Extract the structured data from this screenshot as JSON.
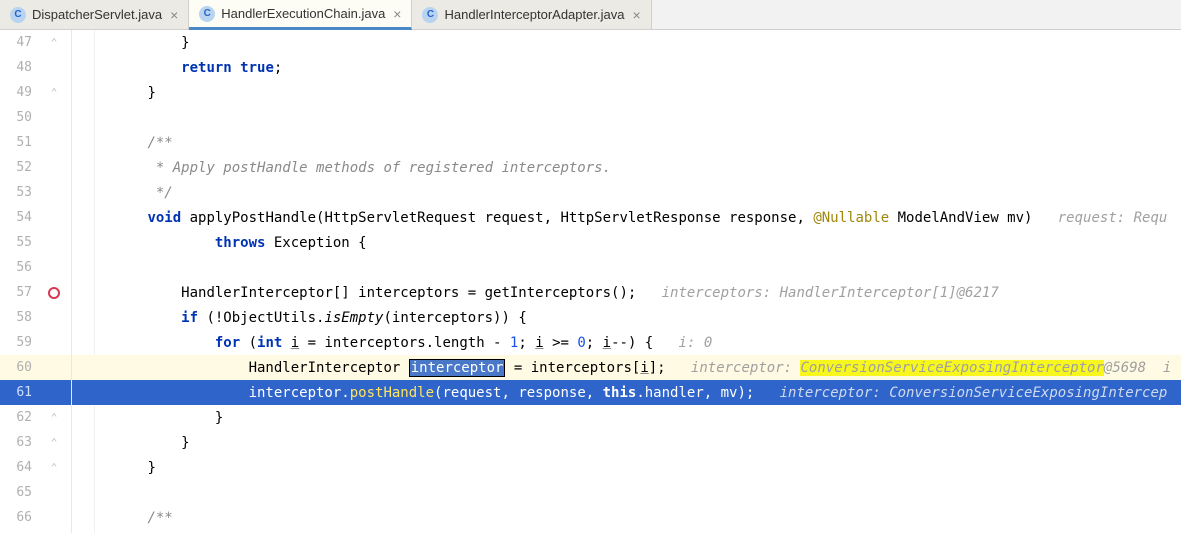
{
  "tabs": [
    {
      "label": "DispatcherServlet.java",
      "active": false
    },
    {
      "label": "HandlerExecutionChain.java",
      "active": true
    },
    {
      "label": "HandlerInterceptorAdapter.java",
      "active": false
    }
  ],
  "icon_letter": "C",
  "lines": [
    {
      "no": "47",
      "marker": "fold",
      "indent": "            ",
      "tokens": [
        {
          "t": "}",
          "c": ""
        }
      ]
    },
    {
      "no": "48",
      "marker": "",
      "indent": "            ",
      "tokens": [
        {
          "t": "return true",
          "c": "kw"
        },
        {
          "t": ";",
          "c": ""
        }
      ]
    },
    {
      "no": "49",
      "marker": "fold",
      "indent": "        ",
      "tokens": [
        {
          "t": "}",
          "c": ""
        }
      ]
    },
    {
      "no": "50",
      "marker": "",
      "indent": "",
      "tokens": []
    },
    {
      "no": "51",
      "marker": "",
      "indent": "        ",
      "tokens": [
        {
          "t": "/**",
          "c": "cm"
        }
      ]
    },
    {
      "no": "52",
      "marker": "",
      "indent": "        ",
      "tokens": [
        {
          "t": " * Apply postHandle methods of registered interceptors.",
          "c": "cm"
        }
      ]
    },
    {
      "no": "53",
      "marker": "",
      "indent": "        ",
      "tokens": [
        {
          "t": " */",
          "c": "cm"
        }
      ]
    },
    {
      "no": "54",
      "marker": "",
      "indent": "        ",
      "tokens": [
        {
          "t": "void",
          "c": "kw"
        },
        {
          "t": " applyPostHandle(HttpServletRequest request, HttpServletResponse response, ",
          "c": ""
        },
        {
          "t": "@Nullable",
          "c": "ann"
        },
        {
          "t": " ModelAndView mv)   ",
          "c": ""
        },
        {
          "t": "request: Requ",
          "c": "hint"
        }
      ]
    },
    {
      "no": "55",
      "marker": "",
      "indent": "                ",
      "tokens": [
        {
          "t": "throws",
          "c": "kw"
        },
        {
          "t": " Exception {",
          "c": ""
        }
      ]
    },
    {
      "no": "56",
      "marker": "",
      "indent": "",
      "tokens": []
    },
    {
      "no": "57",
      "marker": "bp",
      "indent": "            ",
      "tokens": [
        {
          "t": "HandlerInterceptor[] interceptors = getInterceptors();   ",
          "c": ""
        },
        {
          "t": "interceptors: HandlerInterceptor[1]@6217",
          "c": "hint"
        }
      ]
    },
    {
      "no": "58",
      "marker": "",
      "indent": "            ",
      "tokens": [
        {
          "t": "if",
          "c": "kw"
        },
        {
          "t": " (!ObjectUtils.",
          "c": ""
        },
        {
          "t": "isEmpty",
          "c": "static"
        },
        {
          "t": "(interceptors)) {",
          "c": ""
        }
      ]
    },
    {
      "no": "59",
      "marker": "",
      "indent": "                ",
      "tokens": [
        {
          "t": "for",
          "c": "kw"
        },
        {
          "t": " (",
          "c": ""
        },
        {
          "t": "int",
          "c": "kw"
        },
        {
          "t": " ",
          "c": ""
        },
        {
          "t": "i",
          "c": "u"
        },
        {
          "t": " = interceptors.length - ",
          "c": ""
        },
        {
          "t": "1",
          "c": "num"
        },
        {
          "t": "; ",
          "c": ""
        },
        {
          "t": "i",
          "c": "u"
        },
        {
          "t": " >= ",
          "c": ""
        },
        {
          "t": "0",
          "c": "num"
        },
        {
          "t": "; ",
          "c": ""
        },
        {
          "t": "i",
          "c": "u"
        },
        {
          "t": "--) {   ",
          "c": ""
        },
        {
          "t": "i: 0",
          "c": "hint"
        }
      ]
    },
    {
      "no": "60",
      "marker": "",
      "row_hl": "yellow",
      "indent": "                    ",
      "tokens": [
        {
          "t": "HandlerInterceptor ",
          "c": ""
        },
        {
          "t": "interceptor",
          "c": "sel-box"
        },
        {
          "t": " = interceptors[",
          "c": ""
        },
        {
          "t": "i",
          "c": "u"
        },
        {
          "t": "];   ",
          "c": ""
        },
        {
          "t": "interceptor: ",
          "c": "hint"
        },
        {
          "t": "ConversionServiceExposingInterceptor",
          "c": "hint hl-mark"
        },
        {
          "t": "@5698  i",
          "c": "hint"
        }
      ]
    },
    {
      "no": "61",
      "marker": "",
      "row_hl": "blue",
      "indent": "                    ",
      "tokens": [
        {
          "t": "interceptor.",
          "c": ""
        },
        {
          "t": "postHandle",
          "c": "method-y"
        },
        {
          "t": "(request, response, ",
          "c": ""
        },
        {
          "t": "this",
          "c": "kw"
        },
        {
          "t": ".handler, mv);   ",
          "c": ""
        },
        {
          "t": "interceptor: ConversionServiceExposingIntercep",
          "c": "hint-i"
        }
      ]
    },
    {
      "no": "62",
      "marker": "fold",
      "indent": "                ",
      "tokens": [
        {
          "t": "}",
          "c": ""
        }
      ]
    },
    {
      "no": "63",
      "marker": "fold",
      "indent": "            ",
      "tokens": [
        {
          "t": "}",
          "c": ""
        }
      ]
    },
    {
      "no": "64",
      "marker": "fold",
      "indent": "        ",
      "tokens": [
        {
          "t": "}",
          "c": ""
        }
      ]
    },
    {
      "no": "65",
      "marker": "",
      "indent": "",
      "tokens": []
    },
    {
      "no": "66",
      "marker": "",
      "indent": "        ",
      "tokens": [
        {
          "t": "/**",
          "c": "cm"
        }
      ]
    }
  ]
}
